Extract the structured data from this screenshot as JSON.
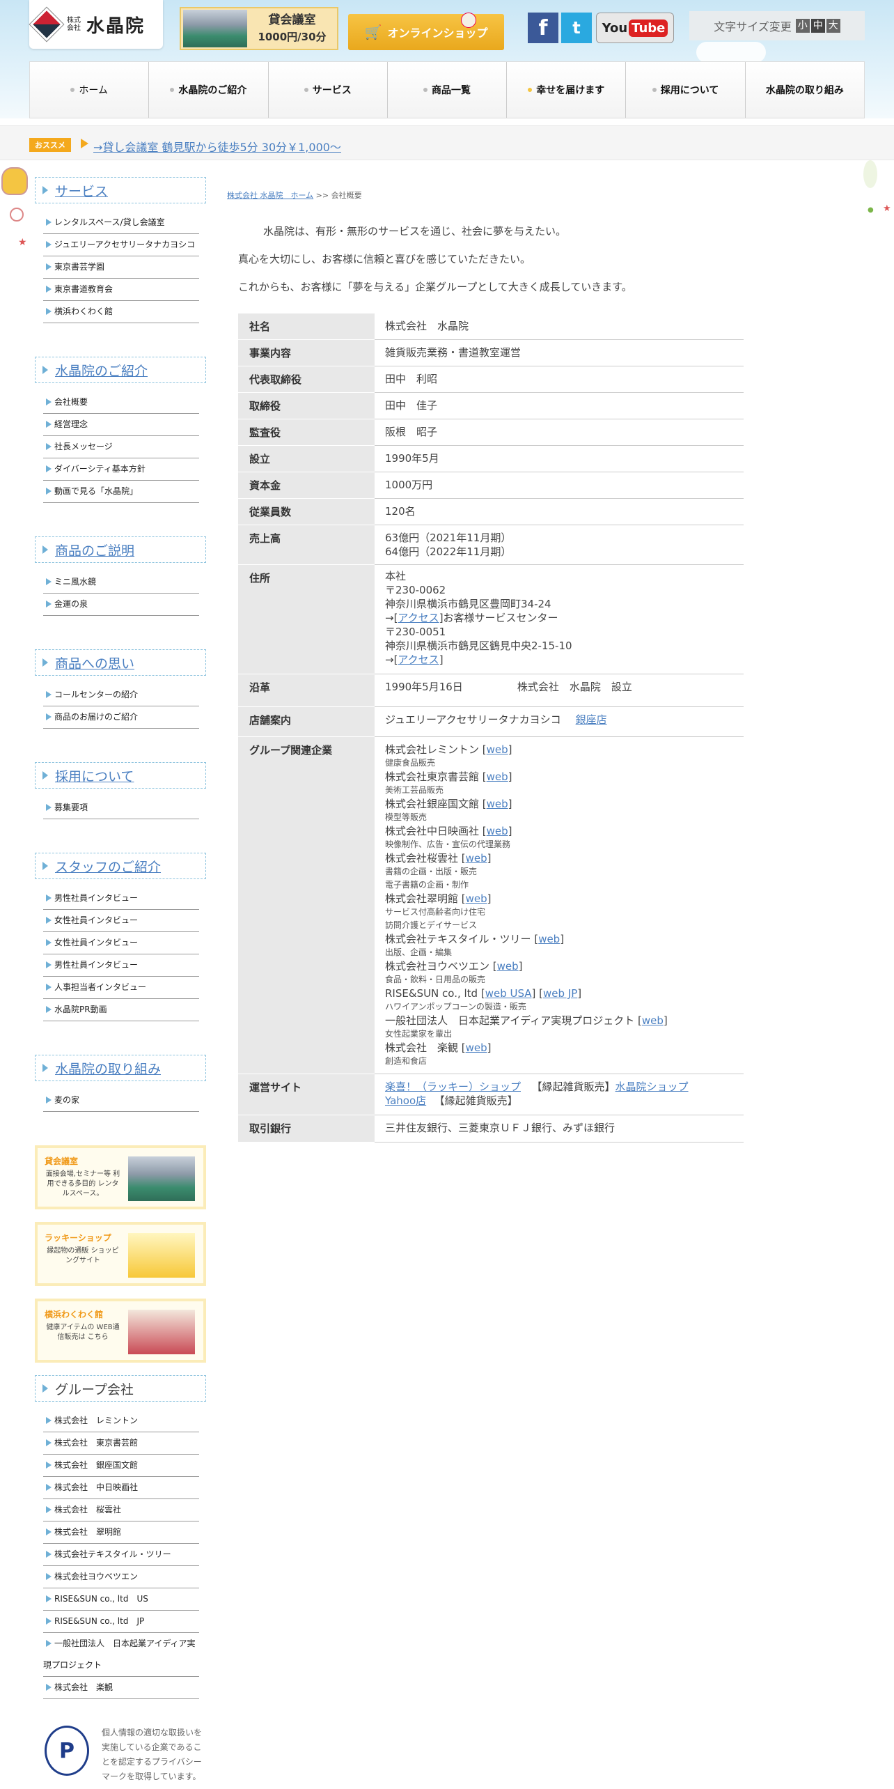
{
  "header": {
    "logo_small": "株式会社",
    "logo_name": "水晶院",
    "kaigi_title": "貸会議室",
    "kaigi_price": "1000円/30分",
    "shop_label": "オンラインショップ",
    "fb": "f",
    "tw": "t",
    "yt_you": "You",
    "yt_tube": "Tube",
    "font_size_label": "文字サイズ変更",
    "font_small": "小",
    "font_mid": "中",
    "font_large": "大"
  },
  "nav": [
    {
      "label": "ホーム"
    },
    {
      "label": "水晶院のご紹介"
    },
    {
      "label": "サービス"
    },
    {
      "label": "商品一覧"
    },
    {
      "label": "幸せを届けます"
    },
    {
      "label": "採用について"
    },
    {
      "label": "水晶院の取り組み"
    }
  ],
  "news": {
    "badge": "おススメ",
    "text": "→貸し会議室 鶴見駅から徒歩5分 30分￥1,000～"
  },
  "sidebar": {
    "sections": [
      {
        "title": "サービス",
        "items": [
          "レンタルスペース/貸し会議室",
          "ジュエリーアクセサリータナカヨシコ",
          "東京書芸学園",
          "東京書道教育会",
          "横浜わくわく館"
        ]
      },
      {
        "title": "水晶院のご紹介",
        "items": [
          "会社概要",
          "経営理念",
          "社長メッセージ",
          "ダイバーシティ基本方針",
          "動画で見る「水晶院」"
        ]
      },
      {
        "title": "商品のご説明",
        "items": [
          "ミニ風水鏡",
          "金運の泉"
        ]
      },
      {
        "title": "商品への思い",
        "items": [
          "コールセンターの紹介",
          "商品のお届けのご紹介"
        ]
      },
      {
        "title": "採用について",
        "items": [
          "募集要項"
        ]
      },
      {
        "title": "スタッフのご紹介",
        "items": [
          "男性社員インタビュー",
          "女性社員インタビュー",
          "女性社員インタビュー",
          "男性社員インタビュー",
          "人事担当者インタビュー",
          "水晶院PR動画"
        ]
      },
      {
        "title": "水晶院の取り組み",
        "items": [
          "麦の家"
        ]
      }
    ],
    "banners": [
      {
        "title": "貸会議室",
        "desc": "面接会場,セミナー等 利用できる多目的 レンタルスペース。"
      },
      {
        "title": "ラッキーショップ",
        "desc": "縁起物の通販 ショッピングサイト"
      },
      {
        "title": "横浜わくわく館",
        "desc": "健康アイテムの WEB通信販売は こちら"
      }
    ],
    "group_title": "グループ会社",
    "group_items": [
      "株式会社　レミントン",
      "株式会社　東京書芸館",
      "株式会社　銀座国文館",
      "株式会社　中日映画社",
      "株式会社　桜雲社",
      "株式会社　翠明館",
      "株式会社テキスタイル・ツリー",
      "株式会社ヨウベツエン",
      "RISE&SUN co., ltd　US",
      "RISE&SUN co., ltd　JP",
      "一般社団法人　日本起業アイディア実現プロジェクト",
      "株式会社　楽観"
    ],
    "privacy_mark": "P",
    "privacy_text": "個人情報の適切な取扱いを実施している企業であることを認定するプライバシーマークを取得しています。"
  },
  "breadcrumb": {
    "home": "株式会社 水晶院　ホーム",
    "sep": ">>",
    "current": "会社概要"
  },
  "intro": [
    "水晶院は、有形・無形のサービスを通じ、社会に夢を与えたい。",
    "真心を大切にし、お客様に信頼と喜びを感じていただきたい。",
    "これからも、お客様に「夢を与える」企業グループとして大きく成長していきます。"
  ],
  "company": {
    "name_label": "社名",
    "name": "株式会社　水晶院",
    "business_label": "事業内容",
    "business": "雑貨販売業務・書道教室運営",
    "ceo_label": "代表取締役",
    "ceo": "田中　利昭",
    "director_label": "取締役",
    "director": "田中　佳子",
    "auditor_label": "監査役",
    "auditor": "阪根　昭子",
    "founded_label": "設立",
    "founded": "1990年5月",
    "capital_label": "資本金",
    "capital": "1000万円",
    "employees_label": "従業員数",
    "employees": "120名",
    "sales_label": "売上高",
    "sales_1": "63億円（2021年11月期）",
    "sales_2": "64億円（2022年11月期）",
    "address_label": "住所",
    "addr_head": "本社",
    "addr_zip1": "〒230-0062",
    "addr_1": "神奈川県横浜市鶴見区豊岡町34-24",
    "access": "アクセス",
    "addr_center": "お客様サービスセンター",
    "addr_zip2": "〒230-0051",
    "addr_2": "神奈川県横浜市鶴見区鶴見中央2-15-10",
    "history_label": "沿革",
    "history_date": "1990年5月16日",
    "history_event": "株式会社　水晶院　設立",
    "store_label": "店舗案内",
    "store_name": "ジュエリーアクセサリータナカヨシコ",
    "store_link": "銀座店",
    "group_label": "グループ関連企業",
    "web": "web",
    "web_usa": "web USA",
    "web_jp": "web JP",
    "groups": [
      {
        "name": "株式会社レミントン",
        "desc": [
          "健康食品販売"
        ]
      },
      {
        "name": "株式会社東京書芸館",
        "desc": [
          "美術工芸品販売"
        ]
      },
      {
        "name": "株式会社銀座国文館",
        "desc": [
          "模型等販売"
        ]
      },
      {
        "name": "株式会社中日映画社",
        "desc": [
          "映像制作、広告・宣伝の代理業務"
        ]
      },
      {
        "name": "株式会社桜雲社",
        "desc": [
          "書籍の企画・出版・販売",
          "電子書籍の企画・制作"
        ]
      },
      {
        "name": "株式会社翠明館",
        "desc": [
          "サービス付高齢者向け住宅",
          "訪問介護とデイサービス"
        ]
      },
      {
        "name": "株式会社テキスタイル・ツリー",
        "desc": [
          "出版、企画・編集"
        ]
      },
      {
        "name": "株式会社ヨウベツエン",
        "desc": [
          "食品・飲料・日用品の販売"
        ]
      },
      {
        "name": "RISE&SUN co., ltd",
        "desc": [
          "ハワイアンポップコーンの製造・販売"
        ]
      },
      {
        "name": "一般社団法人　日本起業アイディア実現プロジェクト",
        "desc": [
          "女性起業家を輩出"
        ]
      },
      {
        "name": "株式会社　楽観",
        "desc": [
          "創造和食店"
        ]
      }
    ],
    "sites_label": "運営サイト",
    "site1": "楽喜！（ラッキー）ショップ",
    "site1_note": "【縁起雑貨販売】",
    "site2": "水晶院ショップ",
    "site3": "Yahoo店",
    "site3_note": "【縁起雑貨販売】",
    "banks_label": "取引銀行",
    "banks": "三井住友銀行、三菱東京ＵＦＪ銀行、みずほ銀行"
  }
}
